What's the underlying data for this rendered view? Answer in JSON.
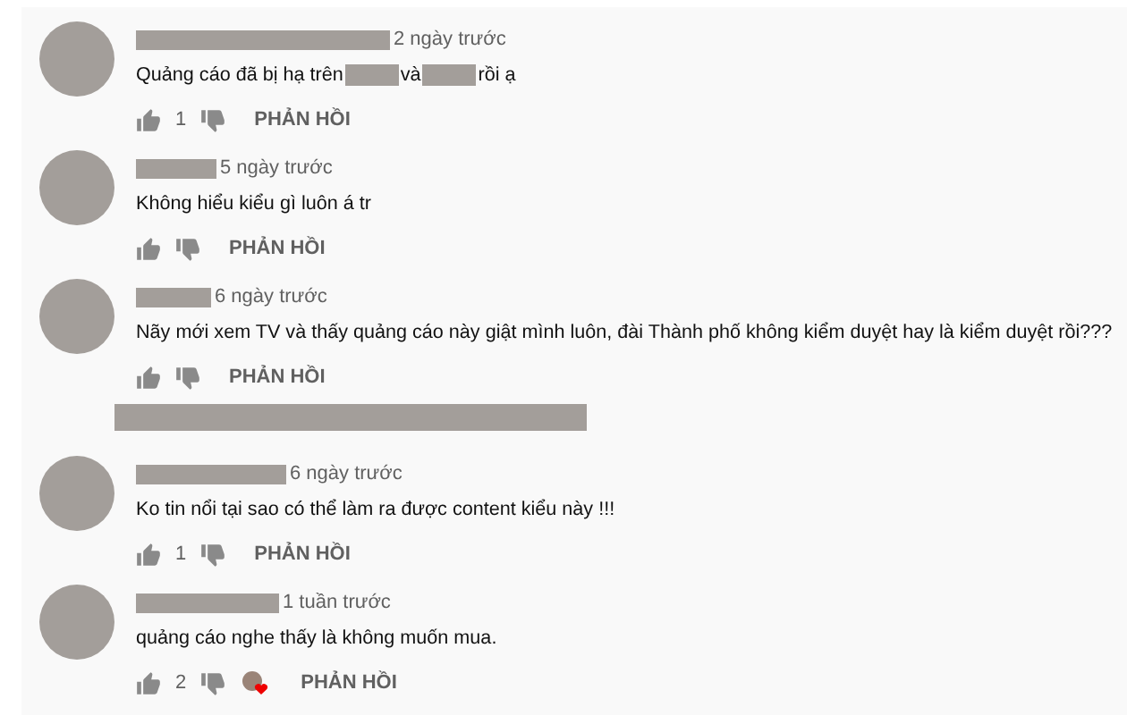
{
  "comments": [
    {
      "kind": "comment",
      "time": "2 ngày trước",
      "parts": [
        {
          "kind": "text",
          "text": "Quảng cáo đã bị hạ trên"
        },
        {
          "kind": "redacted"
        },
        {
          "kind": "text",
          "text": "và"
        },
        {
          "kind": "redacted"
        },
        {
          "kind": "text",
          "text": "rồi ạ"
        }
      ],
      "likes": "1",
      "hearted": false,
      "reply": "PHẢN HỒI"
    },
    {
      "kind": "comment",
      "time": "5 ngày trước",
      "parts": [
        {
          "kind": "text",
          "text": "Không hiểu kiểu gì luôn á tr"
        }
      ],
      "hearted": false,
      "reply": "PHẢN HỒI"
    },
    {
      "kind": "comment",
      "time": "6 ngày trước",
      "parts": [
        {
          "kind": "text",
          "text": "Nãy mới xem TV và thấy quảng cáo này giật mình luôn, đài Thành phố không kiểm duyệt hay là kiểm duyệt rồi???"
        }
      ],
      "hearted": false,
      "reply": "PHẢN HỒI"
    },
    {
      "kind": "redacted-row"
    },
    {
      "kind": "comment",
      "time": "6 ngày trước",
      "parts": [
        {
          "kind": "text",
          "text": "Ko tin nổi tại sao có thể làm ra được content kiểu này !!!"
        }
      ],
      "likes": "1",
      "hearted": false,
      "reply": "PHẢN HỒI"
    },
    {
      "kind": "comment",
      "time": "1 tuần trước",
      "parts": [
        {
          "kind": "text",
          "text": "quảng cáo nghe thấy là không muốn mua."
        }
      ],
      "likes": "2",
      "hearted": true,
      "reply": "PHẢN HỒI"
    }
  ]
}
